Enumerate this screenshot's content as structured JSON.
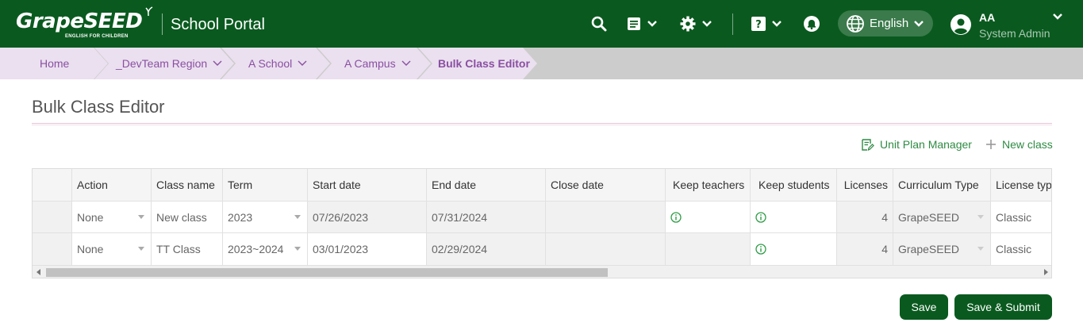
{
  "header": {
    "logo_text": "GrapeSEED",
    "logo_tagline": "ENGLISH FOR CHILDREN",
    "portal_title": "School Portal",
    "language": "English",
    "user_initials": "AA",
    "user_role": "System Admin",
    "brand_color": "#0a5a1f"
  },
  "breadcrumb": [
    {
      "label": "Home"
    },
    {
      "label": "_DevTeam Region"
    },
    {
      "label": "A School"
    },
    {
      "label": "A Campus"
    },
    {
      "label": "Bulk Class Editor"
    }
  ],
  "page": {
    "title": "Bulk Class Editor",
    "unit_plan_manager": "Unit Plan Manager",
    "new_class": "New class"
  },
  "table": {
    "columns": [
      "Action",
      "Class name",
      "Term",
      "Start date",
      "End date",
      "Close date",
      "Keep teachers",
      "Keep students",
      "Licenses",
      "Curriculum Type",
      "License typ"
    ],
    "rows": [
      {
        "action": "None",
        "class_name": "New class",
        "term": "2023",
        "start_date": "07/26/2023",
        "end_date": "07/31/2024",
        "close_date": "",
        "keep_teachers": "info-icon",
        "keep_students": "info-icon",
        "licenses": "4",
        "curriculum_type": "GrapeSEED",
        "license_type": "Classic"
      },
      {
        "action": "None",
        "class_name": "TT Class",
        "term": "2023~2024",
        "start_date": "03/01/2023",
        "end_date": "02/29/2024",
        "close_date": "",
        "keep_teachers": "",
        "keep_students": "info-icon",
        "licenses": "4",
        "curriculum_type": "GrapeSEED",
        "license_type": "Classic"
      }
    ]
  },
  "footer": {
    "save": "Save",
    "save_submit": "Save & Submit"
  }
}
